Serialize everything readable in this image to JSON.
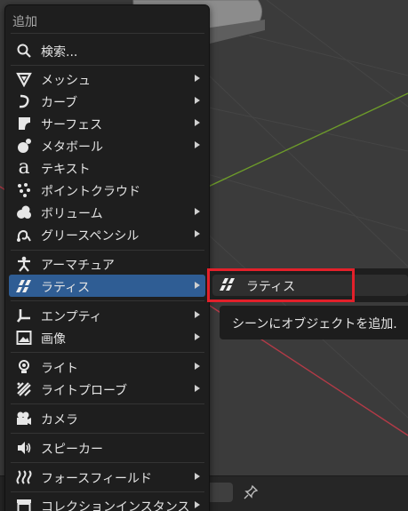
{
  "menu": {
    "title": "追加",
    "search_label": "検索...",
    "items": [
      {
        "label": "メッシュ",
        "icon": "mesh-icon",
        "submenu": true
      },
      {
        "label": "カーブ",
        "icon": "curve-icon",
        "submenu": true
      },
      {
        "label": "サーフェス",
        "icon": "surface-icon",
        "submenu": true
      },
      {
        "label": "メタボール",
        "icon": "metaball-icon",
        "submenu": true
      },
      {
        "label": "テキスト",
        "icon": "text-icon",
        "submenu": false
      },
      {
        "label": "ポイントクラウド",
        "icon": "pointcloud-icon",
        "submenu": false
      },
      {
        "label": "ボリューム",
        "icon": "volume-icon",
        "submenu": true
      },
      {
        "label": "グリースペンシル",
        "icon": "grease-pencil-icon",
        "submenu": true
      },
      {
        "label": "アーマチュア",
        "icon": "armature-icon",
        "submenu": false
      },
      {
        "label": "ラティス",
        "icon": "lattice-icon",
        "submenu": true,
        "active": true
      },
      {
        "label": "エンプティ",
        "icon": "empty-icon",
        "submenu": true
      },
      {
        "label": "画像",
        "icon": "image-icon",
        "submenu": true
      },
      {
        "label": "ライト",
        "icon": "light-icon",
        "submenu": true
      },
      {
        "label": "ライトプローブ",
        "icon": "light-probe-icon",
        "submenu": true
      },
      {
        "label": "カメラ",
        "icon": "camera-icon",
        "submenu": false
      },
      {
        "label": "スピーカー",
        "icon": "speaker-icon",
        "submenu": false
      },
      {
        "label": "フォースフィールド",
        "icon": "force-field-icon",
        "submenu": true
      },
      {
        "label": "コレクションインスタンス",
        "icon": "collection-icon",
        "submenu": true
      }
    ]
  },
  "submenu": {
    "items": [
      {
        "label": "ラティス",
        "icon": "lattice-icon"
      }
    ]
  },
  "tooltip": {
    "text": "シーンにオブジェクトを追加."
  },
  "colors": {
    "menu_bg": "#1e1e1e",
    "active_bg": "#2f5d94",
    "highlight": "#e3202a",
    "axis_x": "#b33a47",
    "axis_y": "#6d9b2a"
  }
}
